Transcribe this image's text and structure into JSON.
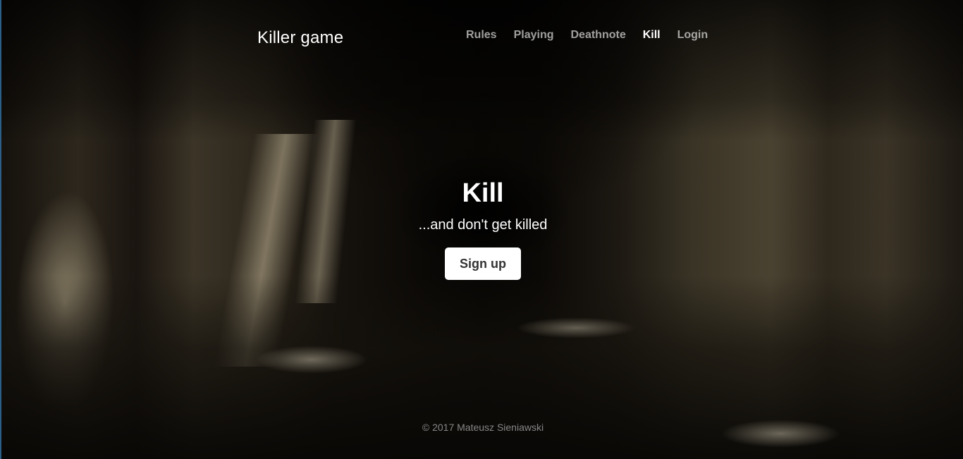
{
  "header": {
    "brand": "Killer game",
    "nav": [
      {
        "label": "Rules",
        "active": false
      },
      {
        "label": "Playing",
        "active": false
      },
      {
        "label": "Deathnote",
        "active": false
      },
      {
        "label": "Kill",
        "active": true
      },
      {
        "label": "Login",
        "active": false
      }
    ]
  },
  "hero": {
    "title": "Kill",
    "subtitle": "...and don't get killed",
    "cta_label": "Sign up"
  },
  "footer": {
    "copyright": "© 2017 Mateusz Sieniawski"
  },
  "colors": {
    "text": "#ffffff",
    "nav_inactive": "#a3a3a3",
    "button_bg": "#ffffff",
    "button_text": "#333333"
  }
}
